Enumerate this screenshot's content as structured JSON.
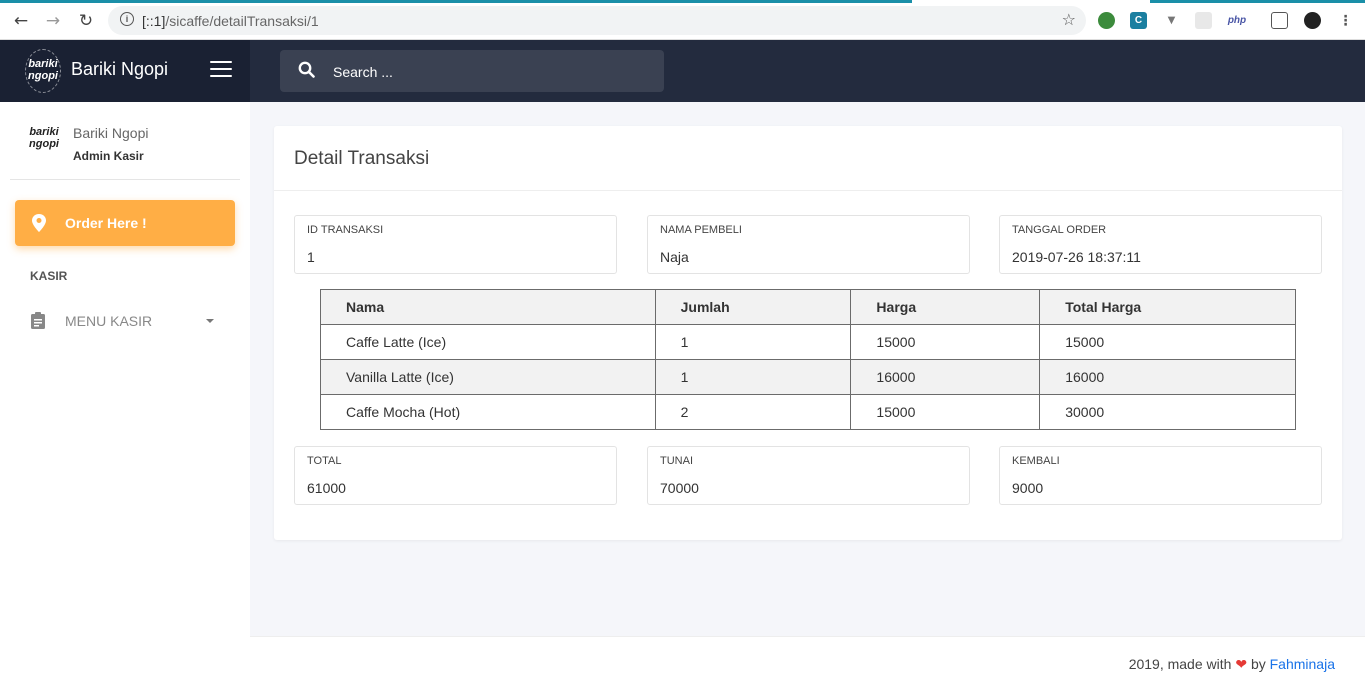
{
  "browser": {
    "url_host": "[::1]",
    "url_path": "/sicaffe/detailTransaksi/1"
  },
  "app": {
    "brand_name": "Bariki Ngopi",
    "logo_text": "bariki ngopi",
    "search_placeholder": "Search ..."
  },
  "sidebar": {
    "user_name": "Bariki Ngopi",
    "user_role": "Admin Kasir",
    "order_button": "Order Here !",
    "section_title": "KASIR",
    "menu_label": "MENU KASIR",
    "accent_color": "#ffae45"
  },
  "detail": {
    "title": "Detail Transaksi",
    "id_label": "ID TRANSAKSI",
    "id_value": "1",
    "buyer_label": "NAMA PEMBELI",
    "buyer_value": "Naja",
    "date_label": "TANGGAL ORDER",
    "date_value": "2019-07-26 18:37:11",
    "columns": [
      "Nama",
      "Jumlah",
      "Harga",
      "Total Harga"
    ],
    "rows": [
      [
        "Caffe Latte (Ice)",
        "1",
        "15000",
        "15000"
      ],
      [
        "Vanilla Latte (Ice)",
        "1",
        "16000",
        "16000"
      ],
      [
        "Caffe Mocha (Hot)",
        "2",
        "15000",
        "30000"
      ]
    ],
    "total_label": "TOTAL",
    "total_value": "61000",
    "cash_label": "TUNAI",
    "cash_value": "70000",
    "change_label": "KEMBALI",
    "change_value": "9000"
  },
  "footer": {
    "prefix": "2019, made with",
    "by": "by",
    "author": "Fahminaja"
  }
}
